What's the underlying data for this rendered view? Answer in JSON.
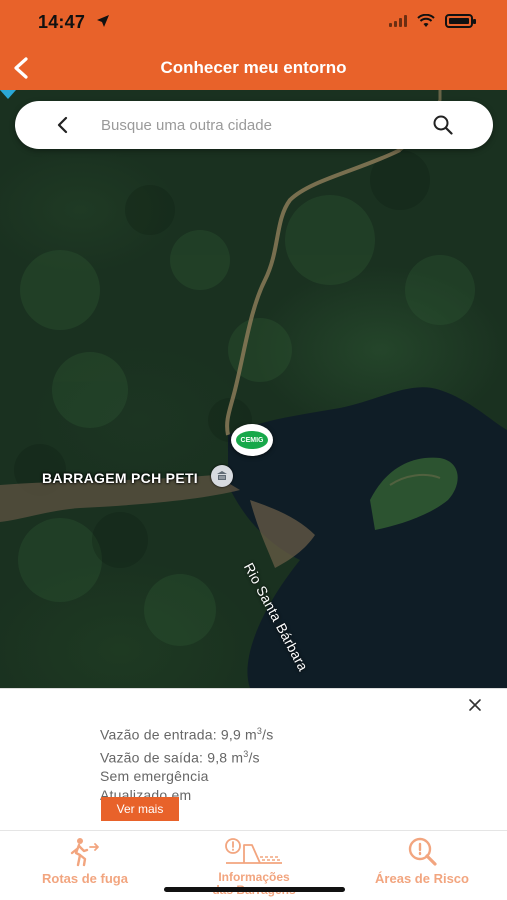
{
  "status_bar": {
    "time": "14:47"
  },
  "header": {
    "title": "Conhecer meu entorno"
  },
  "search": {
    "placeholder": "Busque uma outra cidade"
  },
  "map": {
    "dam_label": "BARRAGEM PCH PETI",
    "river_label": "Rio Santa Bárbara",
    "marker_label": "CEMIG"
  },
  "info": {
    "vazao_entrada": "Vazão de entrada: 9,9 m",
    "vazao_entrada_unit": "3",
    "vazao_entrada_suffix": "/s",
    "vazao_saida": "Vazão de saída: 9,8 m",
    "vazao_saida_unit": "3",
    "vazao_saida_suffix": "/s",
    "status": "Sem emergência",
    "updated": "Atualizado em",
    "button": "Ver mais"
  },
  "bottom_nav": {
    "items": [
      {
        "label": "Rotas de fuga",
        "icon": "walking-person-icon"
      },
      {
        "label": "Informações das Barragens",
        "label_line1": "Informações",
        "label_line2": "das Barragens",
        "icon": "dam-info-icon"
      },
      {
        "label": "Áreas de Risco",
        "icon": "magnifier-alert-icon"
      }
    ]
  },
  "colors": {
    "accent": "#e8622a",
    "nav_inactive": "#f2a57f",
    "river": "#0f1d26"
  }
}
